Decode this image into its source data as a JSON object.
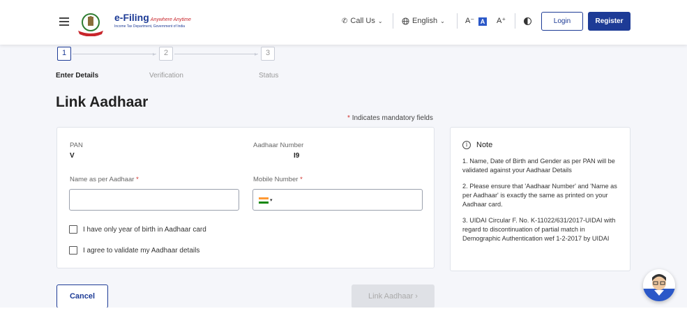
{
  "header": {
    "logo_title": "e-Filing",
    "logo_tagline": "Anywhere Anytime",
    "logo_subtitle": "Income Tax Department, Government of India",
    "call_us": "Call Us",
    "language": "English",
    "font_decrease": "A⁻",
    "font_default": "A",
    "font_increase": "A⁺",
    "login": "Login",
    "register": "Register"
  },
  "stepper": {
    "steps": [
      {
        "number": "1",
        "label": "Enter Details"
      },
      {
        "number": "2",
        "label": "Verification"
      },
      {
        "number": "3",
        "label": "Status"
      }
    ]
  },
  "page": {
    "title": "Link Aadhaar",
    "mandatory_star": "*",
    "mandatory_text": "Indicates mandatory fields"
  },
  "form": {
    "pan_label": "PAN",
    "pan_value": "V",
    "aadhaar_label": "Aadhaar Number",
    "aadhaar_value": "I9",
    "name_label": "Name as per Aadhaar",
    "name_value": "",
    "mobile_label": "Mobile Number",
    "mobile_value": "",
    "required_star": "*",
    "checkbox_year": "I have only year of birth in Aadhaar card",
    "checkbox_agree": "I agree to validate my Aadhaar details"
  },
  "note": {
    "title": "Note",
    "items": [
      "1. Name, Date of Birth and Gender as per PAN will be validated against your Aadhaar Details",
      "2. Please ensure that 'Aadhaar Number' and 'Name as per Aadhaar' is exactly the same as printed on your Aadhaar card.",
      "3. UIDAI Circular F. No. K-11022/631/2017-UIDAI with regard to discontinuation of partial match in Demographic Authentication wef 1-2-2017 by UIDAI"
    ]
  },
  "buttons": {
    "cancel": "Cancel",
    "link_aadhaar": "Link Aadhaar",
    "link_chevron": "›"
  },
  "colors": {
    "primary": "#1d3b96",
    "accent_blue": "#2b58c8",
    "required_red": "#d0312d",
    "page_bg": "#f5f6fa",
    "disabled_bg": "#dfe1e6"
  },
  "icons": [
    "hamburger-icon",
    "phone-icon",
    "globe-icon",
    "contrast-icon",
    "info-icon",
    "india-flag-icon",
    "chatbot-icon"
  ]
}
